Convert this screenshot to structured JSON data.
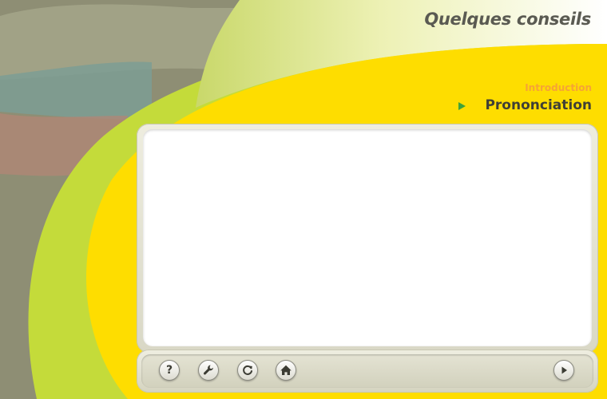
{
  "header": {
    "title": "Quelques conseils"
  },
  "nav": {
    "intro_label": "Introduction",
    "current_label": "Prononciation"
  },
  "toolbar": {
    "help_glyph": "?",
    "buttons": [
      "help-icon",
      "settings-wrench-icon",
      "replay-icon",
      "home-icon",
      "next-icon"
    ]
  },
  "colors": {
    "accent_yellow": "#fedd00",
    "lime_green": "#c4db3a",
    "intro_orange": "#f6a435",
    "title_gray": "#5a5a52",
    "arrow_green": "#3fa23a"
  }
}
